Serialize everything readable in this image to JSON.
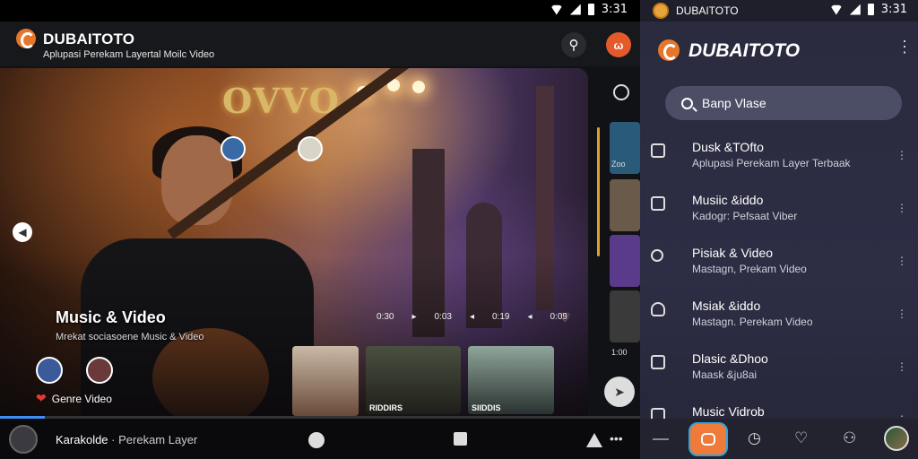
{
  "statusbar_left": {
    "time": "3:31"
  },
  "left_appbar": {
    "brand": "DUBAITOTO",
    "subtitle": "Aplupasi Perekam Layertal Moilc Video"
  },
  "hero": {
    "overlay_logo": "OVVO",
    "title": "Music & Video",
    "subtitle": "Mrekat sociasoene Music & Video",
    "controls": [
      "0:30",
      "▸",
      "0:03",
      "◂",
      "0:19",
      "◂",
      "0:09"
    ],
    "genre_label": "Genre Video",
    "thumb_captions": [
      "",
      "RIDDIRS",
      "SIIDDIS"
    ]
  },
  "right_rail": {
    "thumb_label_1": "Zoo",
    "label_bottom": "1:00"
  },
  "player": {
    "title": "Karakolde",
    "subtitle": "· Perekam Layer",
    "progress_percent": 7
  },
  "statusbar_right": {
    "title": "DUBAITOTO",
    "time": "3:31"
  },
  "right_header": {
    "brand": "DUBAITOTO"
  },
  "right_search": {
    "placeholder": "Banp Vlase"
  },
  "right_list": [
    {
      "icon": "square-icon",
      "title": "Dusk &TOfto",
      "subtitle": "Aplupasi Perekam Layer Terbaak"
    },
    {
      "icon": "square-icon",
      "title": "Musiic &iddo",
      "subtitle": "Kadogr: Pefsaat Viber"
    },
    {
      "icon": "search-icon",
      "title": "Pisiak & Video",
      "subtitle": "Mastagn, Prekam Video"
    },
    {
      "icon": "user-icon",
      "title": "Msiak &iddo",
      "subtitle": "Mastagn. Perekam Video"
    },
    {
      "icon": "square-icon",
      "title": "Dlasic &Dhoo",
      "subtitle": "Maask &ju8ai"
    },
    {
      "icon": "square-icon",
      "title": "Music Vidrob",
      "subtitle": ""
    }
  ],
  "colors": {
    "accent_orange": "#e8762a",
    "progress_blue": "#3d8ff6",
    "right_bg": "#2a2b3d"
  }
}
